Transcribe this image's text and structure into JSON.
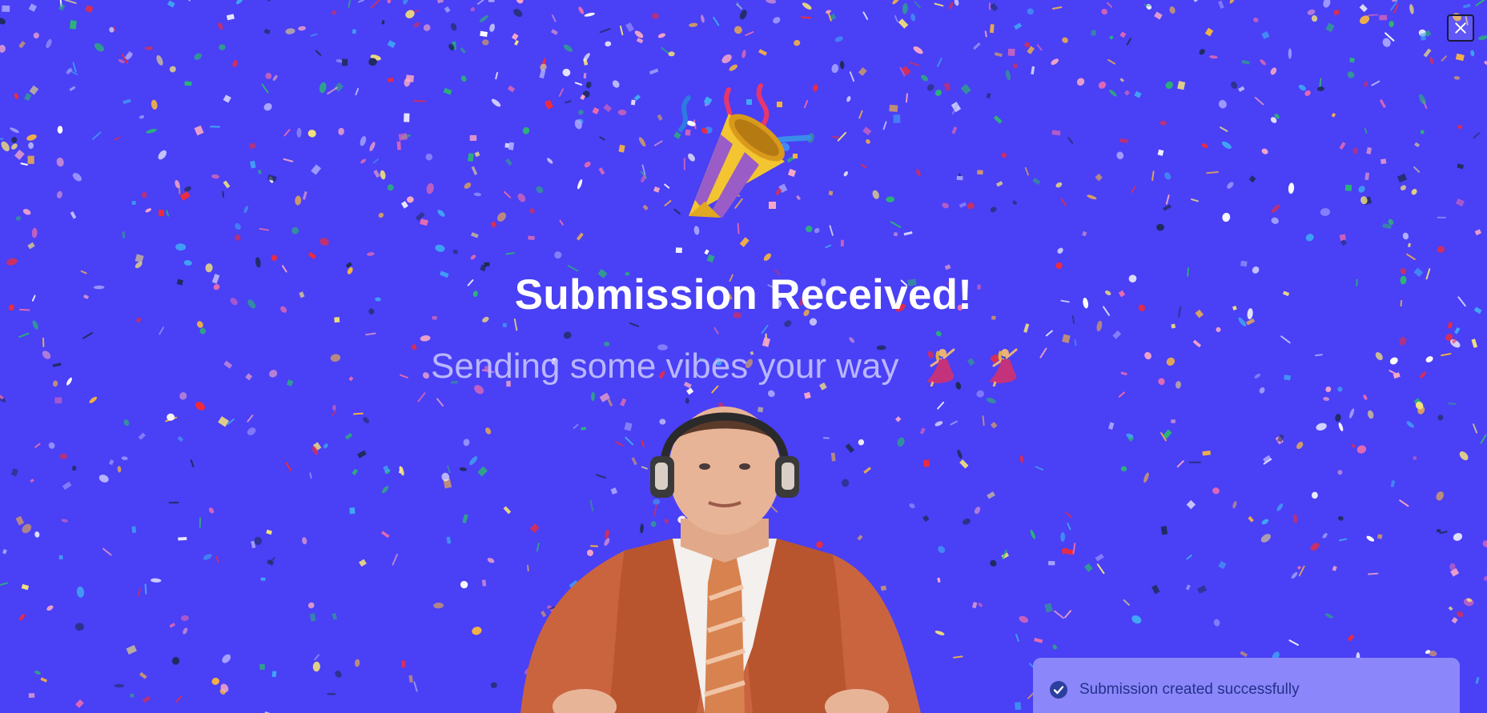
{
  "modal": {
    "close_label": "Close",
    "title": "Submission Received!",
    "subtitle": "Sending some vibes your way",
    "emoji_icons": [
      "party-popper-icon",
      "dancing-woman-icon",
      "dancing-woman-icon"
    ]
  },
  "toast": {
    "message": "Submission created successfully",
    "status": "success"
  },
  "colors": {
    "background": "#4a40f5",
    "title": "#ffffff",
    "subtitle": "#b9b6ff",
    "toast_background": "#8c86fb",
    "toast_text": "#22318a",
    "confetti": [
      "#ffffff",
      "#ef2b3b",
      "#f7a7c6",
      "#f5b342",
      "#1e2a55",
      "#2bb673",
      "#3fa9f5",
      "#a9a4ff",
      "#e86bb0",
      "#f4e27a"
    ]
  }
}
